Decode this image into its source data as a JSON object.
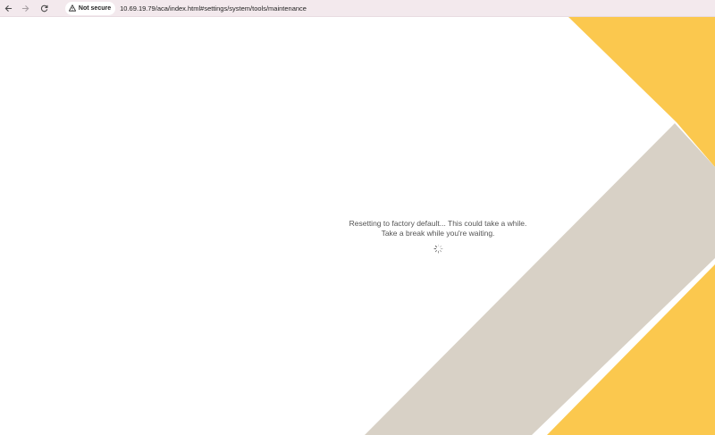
{
  "browser": {
    "security_label": "Not secure",
    "url": "10.69.19.79/aca/index.html#settings/system/tools/maintenance"
  },
  "status": {
    "message": "Resetting to factory default... This could take a while. Take a break while you're waiting."
  },
  "icons": {
    "back": "arrow-left-icon",
    "forward": "arrow-right-icon",
    "reload": "reload-icon",
    "warning": "warning-triangle-icon",
    "spinner": "loading-spinner-icon"
  },
  "colors": {
    "accent_yellow": "#fbc84e",
    "accent_gray": "#d8d1c6",
    "browser_bar": "#f3e9ed",
    "text": "#555555"
  }
}
